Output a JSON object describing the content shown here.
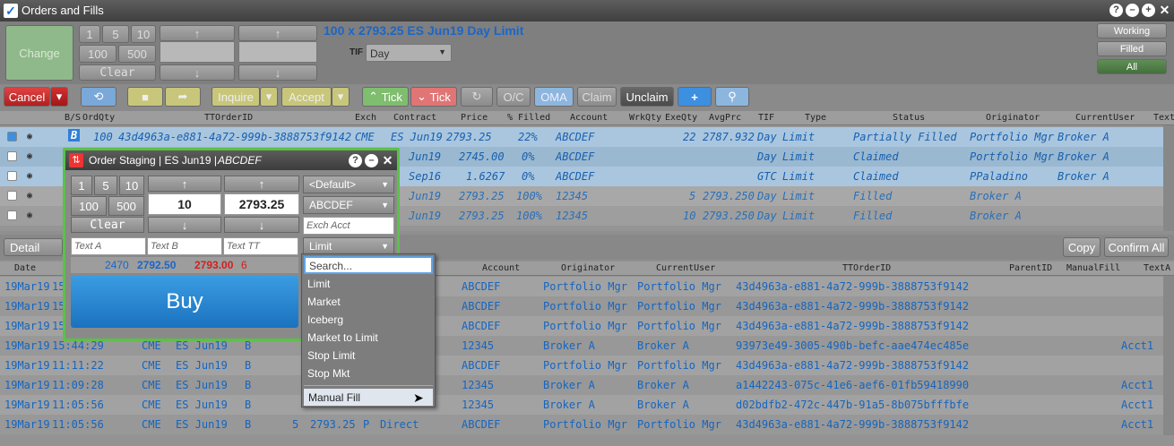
{
  "window": {
    "title": "Orders and Fills"
  },
  "top": {
    "change": "Change",
    "qty": [
      "1",
      "5",
      "10",
      "100",
      "500"
    ],
    "clear": "Clear",
    "order_text": "100 x 2793.25 ES Jun19 Day Limit",
    "tif_label": "TIF",
    "tif_value": "Day",
    "filters": [
      "Working",
      "Filled",
      "All"
    ]
  },
  "toolbar": {
    "cancel": "Cancel",
    "inquire": "Inquire",
    "accept": "Accept",
    "up_tick": "Tick",
    "down_tick": "Tick",
    "oc": "O/C",
    "oma": "OMA",
    "claim": "Claim",
    "unclaim": "Unclaim",
    "plus": "+"
  },
  "orders": {
    "headers": [
      "B/S",
      "OrdQty",
      "TTOrderID",
      "Exch",
      "Contract",
      "Price",
      "% Filled",
      "Account",
      "WrkQty",
      "ExeQty",
      "AvgPrc",
      "TIF",
      "Type",
      "Status",
      "Originator",
      "CurrentUser",
      "Text"
    ],
    "rows": [
      {
        "bs": "B",
        "qty": "100",
        "id": "43d4963a-e881-4a72-999b-3888753f9142",
        "exch": "CME",
        "contract": "ES Jun19",
        "price": "2793.25",
        "filled": "22%",
        "account": "ABCDEF",
        "wrk": "",
        "exe": "22",
        "avg": "2787.932",
        "tif": "Day",
        "type": "Limit",
        "status": "Partially Filled",
        "orig": "Portfolio Mgr",
        "user": "Broker A"
      },
      {
        "bs": "",
        "qty": "",
        "id": "",
        "exch": "",
        "contract": "Jun19",
        "price": "2745.00",
        "filled": "0%",
        "account": "ABCDEF",
        "wrk": "",
        "exe": "",
        "avg": "",
        "tif": "Day",
        "type": "Limit",
        "status": "Claimed",
        "orig": "Portfolio Mgr",
        "user": "Broker A"
      },
      {
        "bs": "",
        "qty": "",
        "id": "",
        "exch": "",
        "contract": "Sep16",
        "price": "1.6267",
        "filled": "0%",
        "account": "ABCDEF",
        "wrk": "",
        "exe": "",
        "avg": "",
        "tif": "GTC",
        "type": "Limit",
        "status": "Claimed",
        "orig": "PPaladino",
        "user": "Broker A"
      },
      {
        "bs": "",
        "qty": "",
        "id": "",
        "exch": "",
        "contract": "Jun19",
        "price": "2793.25",
        "filled": "100%",
        "account": "12345",
        "wrk": "",
        "exe": "5",
        "avg": "2793.250",
        "tif": "Day",
        "type": "Limit",
        "status": "Filled",
        "orig": "Broker A",
        "user": ""
      },
      {
        "bs": "",
        "qty": "",
        "id": "",
        "exch": "",
        "contract": "Jun19",
        "price": "2793.25",
        "filled": "100%",
        "account": "12345",
        "wrk": "",
        "exe": "10",
        "avg": "2793.250",
        "tif": "Day",
        "type": "Limit",
        "status": "Filled",
        "orig": "Broker A",
        "user": ""
      }
    ]
  },
  "fills": {
    "detail": "Detail",
    "copy": "Copy",
    "confirm_all": "Confirm All",
    "headers": [
      "Date",
      "Account",
      "Originator",
      "CurrentUser",
      "TTOrderID",
      "ParentID",
      "ManualFill",
      "TextA"
    ],
    "rows": [
      {
        "date": "19Mar19",
        "time": "15",
        "exch": "",
        "contract": "",
        "bs": "",
        "qty": "",
        "price": "",
        "pf": "",
        "route": "",
        "account": "ABCDEF",
        "orig": "Portfolio Mgr",
        "user": "Portfolio Mgr",
        "id": "43d4963a-e881-4a72-999b-3888753f9142",
        "texta": ""
      },
      {
        "date": "19Mar19",
        "time": "15",
        "exch": "",
        "contract": "",
        "bs": "",
        "qty": "",
        "price": "",
        "pf": "",
        "route": "",
        "account": "ABCDEF",
        "orig": "Portfolio Mgr",
        "user": "Portfolio Mgr",
        "id": "43d4963a-e881-4a72-999b-3888753f9142",
        "texta": ""
      },
      {
        "date": "19Mar19",
        "time": "15",
        "exch": "",
        "contract": "",
        "bs": "",
        "qty": "",
        "price": "",
        "pf": "",
        "route": "",
        "account": "ABCDEF",
        "orig": "Portfolio Mgr",
        "user": "Portfolio Mgr",
        "id": "43d4963a-e881-4a72-999b-3888753f9142",
        "texta": ""
      },
      {
        "date": "19Mar19",
        "time": "15:44:29",
        "exch": "CME",
        "contract": "ES Jun19",
        "bs": "B",
        "qty": "",
        "price": "",
        "pf": "",
        "route": "",
        "account": "12345",
        "orig": "Broker A",
        "user": "Broker A",
        "id": "93973e49-3005-490b-befc-aae474ec485e",
        "texta": "Acct1"
      },
      {
        "date": "19Mar19",
        "time": "11:11:22",
        "exch": "CME",
        "contract": "ES Jun19",
        "bs": "B",
        "qty": "",
        "price": "",
        "pf": "",
        "route": "",
        "account": "ABCDEF",
        "orig": "Portfolio Mgr",
        "user": "Portfolio Mgr",
        "id": "43d4963a-e881-4a72-999b-3888753f9142",
        "texta": ""
      },
      {
        "date": "19Mar19",
        "time": "11:09:28",
        "exch": "CME",
        "contract": "ES Jun19",
        "bs": "B",
        "qty": "",
        "price": "",
        "pf": "",
        "route": "",
        "account": "12345",
        "orig": "Broker A",
        "user": "Broker A",
        "id": "a1442243-075c-41e6-aef6-01fb59418990",
        "texta": "Acct1"
      },
      {
        "date": "19Mar19",
        "time": "11:05:56",
        "exch": "CME",
        "contract": "ES Jun19",
        "bs": "B",
        "qty": "",
        "price": "",
        "pf": "",
        "route": "",
        "account": "12345",
        "orig": "Broker A",
        "user": "Broker A",
        "id": "d02bdfb2-472c-447b-91a5-8b075bfffbfe",
        "texta": "Acct1"
      },
      {
        "date": "19Mar19",
        "time": "11:05:56",
        "exch": "CME",
        "contract": "ES Jun19",
        "bs": "B",
        "qty": "5",
        "price": "2793.25",
        "pf": "P",
        "route": "Direct",
        "account": "ABCDEF",
        "orig": "Portfolio Mgr",
        "user": "Portfolio Mgr",
        "id": "43d4963a-e881-4a72-999b-3888753f9142",
        "texta": "Acct1"
      }
    ]
  },
  "staging": {
    "title": "Order Staging | ES Jun19 | ",
    "account_title": "ABCDEF",
    "qty": [
      "1",
      "5",
      "10",
      "100",
      "500"
    ],
    "clear": "Clear",
    "qty_value": "10",
    "price_value": "2793.25",
    "default": "<Default>",
    "account": "ABCDEF",
    "exch_acct": "Exch Acct",
    "text_a": "Text A",
    "text_b": "Text B",
    "text_tt": "Text TT",
    "type": "Limit",
    "bid_qty": "2470",
    "bid": "2792.50",
    "ask": "2793.00",
    "ask_qty": "6",
    "buy": "Buy"
  },
  "dropdown": {
    "search": "Search...",
    "items": [
      "Limit",
      "Market",
      "Iceberg",
      "Market to Limit",
      "Stop Limit",
      "Stop Mkt"
    ],
    "manual": "Manual Fill"
  }
}
